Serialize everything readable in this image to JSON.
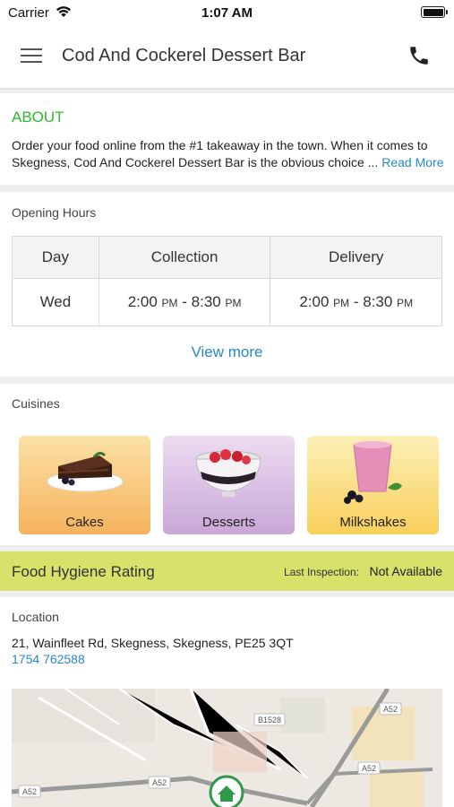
{
  "status_bar": {
    "carrier": "Carrier",
    "time": "1:07 AM"
  },
  "header": {
    "title": "Cod And Cockerel Dessert Bar"
  },
  "about": {
    "title": "ABOUT",
    "text": "Order your food online from the #1 takeaway in the town. When it comes to Skegness, Cod And Cockerel Dessert Bar is the obvious choice ... ",
    "read_more": "Read More"
  },
  "opening_hours": {
    "title": "Opening Hours",
    "columns": [
      "Day",
      "Collection",
      "Delivery"
    ],
    "rows": [
      {
        "day": "Wed",
        "collection_start": "2:00",
        "collection_end": "8:30",
        "delivery_start": "2:00",
        "delivery_end": "8:30"
      }
    ],
    "pm": "PM",
    "separator": " - ",
    "view_more": "View more"
  },
  "cuisines": {
    "title": "Cuisines",
    "items": [
      {
        "label": "Cakes",
        "color_top": "#fbe1a6",
        "color_bottom": "#f6b25c"
      },
      {
        "label": "Desserts",
        "color_top": "#eddcf1",
        "color_bottom": "#c9a7d8"
      },
      {
        "label": "Milkshakes",
        "color_top": "#fdf0b8",
        "color_bottom": "#f8cf5a"
      }
    ]
  },
  "hygiene": {
    "title": "Food Hygiene Rating",
    "inspection_label": "Last Inspection:",
    "inspection_value": "Not Available"
  },
  "location": {
    "title": "Location",
    "address": "21, Wainfleet Rd, Skegness, Skegness, PE25 3QT",
    "phone": "1754 762588",
    "road_labels": [
      "B1528",
      "A52",
      "A52",
      "A52",
      "A52"
    ]
  },
  "colors": {
    "accent_green": "#2dbb2d",
    "link_blue": "#2a88c8",
    "hygiene_bar": "#d6e26a"
  },
  "icons": [
    "wifi-icon",
    "battery-icon",
    "menu-icon",
    "phone-icon",
    "home-pin-icon"
  ]
}
